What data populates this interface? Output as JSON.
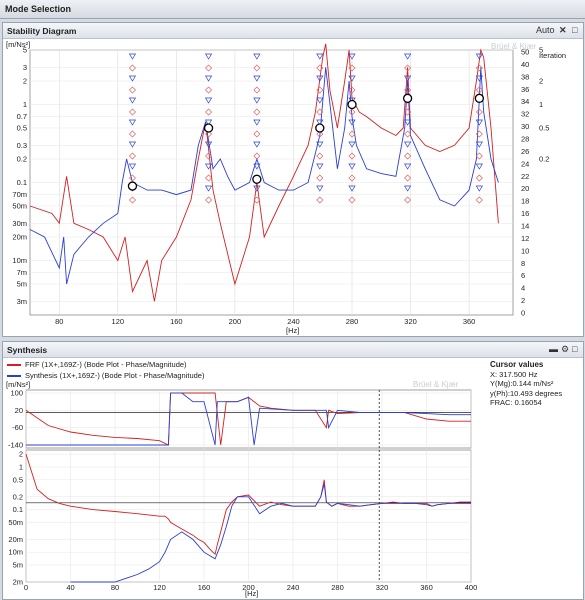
{
  "window": {
    "title": "Mode Selection"
  },
  "stability": {
    "title": "Stability Diagram",
    "auto_label": "Auto",
    "y_unit": "[m/Ns²]",
    "x_unit": "[Hz]",
    "right_title": "Iteration",
    "watermark": "Brüel & Kjær",
    "x_ticks": [
      "80",
      "120",
      "160",
      "200",
      "240",
      "280",
      "320",
      "360"
    ],
    "y_ticks": [
      "5",
      "2",
      "1",
      "0.5",
      "0.2",
      "0.1",
      "50m",
      "20m",
      "10m",
      "5m",
      "3",
      "0.7",
      "0.3",
      "70m",
      "30m",
      "7m",
      "3m"
    ],
    "iter_ticks": [
      "50",
      "40",
      "38",
      "36",
      "34",
      "32",
      "30",
      "28",
      "26",
      "24",
      "22",
      "20",
      "18",
      "16",
      "14",
      "12",
      "10",
      "8",
      "6",
      "4",
      "2",
      "0"
    ],
    "alt_right_ticks": [
      "5",
      "2",
      "1",
      "0.5",
      "0.2"
    ]
  },
  "synthesis": {
    "title": "Synthesis",
    "legend": [
      {
        "label": "FRF (1X+,169Z-) (Bode Plot - Phase/Magnitude)",
        "color": "#d42020"
      },
      {
        "label": "Synthesis (1X+,169Z-) (Bode Plot - Phase/Magnitude)",
        "color": "#2b3fd4"
      }
    ],
    "watermark": "Brüel & Kjær",
    "y_unit": "[m/Ns²]",
    "x_unit": "[Hz]",
    "phase_ticks": [
      "100",
      "20",
      "-60",
      "-140"
    ],
    "mag_ticks": [
      "2",
      "1",
      "0.5",
      "0.2",
      "0.1",
      "50m",
      "20m",
      "10m",
      "5m",
      "2m"
    ],
    "x_ticks": [
      "0",
      "40",
      "80",
      "120",
      "160",
      "200",
      "240",
      "280",
      "320",
      "360",
      "400"
    ]
  },
  "cursor": {
    "title": "Cursor values",
    "x": "X: 317.500 Hz",
    "y_mg": "Y(Mg):0.144 m/Ns²",
    "y_ph": "y(Ph):10.493 degrees",
    "frac": "FRAC: 0.16054"
  },
  "chart_data": [
    {
      "type": "line",
      "title": "Stability Diagram",
      "xlabel": "[Hz]",
      "ylabel": "[m/Ns²]",
      "x_range": [
        60,
        390
      ],
      "y_scale": "log",
      "y_range": [
        0.002,
        5
      ],
      "series": [
        {
          "color": "#d42020",
          "x": [
            60,
            75,
            80,
            85,
            90,
            100,
            110,
            120,
            125,
            130,
            140,
            145,
            150,
            160,
            170,
            175,
            180,
            185,
            190,
            200,
            210,
            215,
            220,
            230,
            240,
            250,
            255,
            260,
            262,
            265,
            270,
            275,
            278,
            280,
            285,
            290,
            300,
            310,
            315,
            318,
            320,
            330,
            340,
            350,
            360,
            365,
            368,
            370,
            375,
            380
          ],
          "y": [
            0.05,
            0.04,
            0.03,
            0.12,
            0.03,
            0.025,
            0.02,
            0.01,
            0.02,
            0.004,
            0.01,
            0.003,
            0.01,
            0.02,
            0.06,
            0.2,
            0.6,
            0.08,
            0.03,
            0.005,
            0.02,
            0.1,
            0.02,
            0.05,
            0.12,
            0.3,
            0.8,
            4,
            6,
            1.5,
            0.5,
            2,
            5,
            1.2,
            0.8,
            0.7,
            0.5,
            0.4,
            0.5,
            3,
            0.5,
            0.3,
            0.25,
            0.3,
            0.5,
            2,
            5,
            4,
            0.5,
            0.03
          ]
        },
        {
          "color": "#2b3fd4",
          "x": [
            60,
            70,
            80,
            83,
            85,
            90,
            100,
            110,
            120,
            123,
            126,
            130,
            140,
            150,
            160,
            170,
            175,
            180,
            185,
            190,
            195,
            200,
            210,
            215,
            220,
            230,
            240,
            250,
            258,
            262,
            265,
            270,
            275,
            278,
            280,
            283,
            290,
            300,
            310,
            316,
            318,
            320,
            330,
            340,
            350,
            360,
            365,
            368,
            370,
            375,
            380
          ],
          "y": [
            0.025,
            0.02,
            0.008,
            0.02,
            0.005,
            0.012,
            0.02,
            0.03,
            0.04,
            0.1,
            0.2,
            0.1,
            0.08,
            0.08,
            0.07,
            0.08,
            0.3,
            0.6,
            0.15,
            0.2,
            0.12,
            0.08,
            0.1,
            0.2,
            0.1,
            0.08,
            0.08,
            0.1,
            0.4,
            3,
            1,
            0.15,
            0.5,
            2,
            0.7,
            0.3,
            0.15,
            0.13,
            0.12,
            0.5,
            2,
            0.4,
            0.15,
            0.06,
            0.05,
            0.08,
            0.2,
            3,
            0.8,
            0.2,
            0.1
          ]
        }
      ],
      "stable_modes_hz": [
        130,
        182,
        215,
        258,
        280,
        318,
        367
      ],
      "stable_modes_y": [
        0.09,
        0.5,
        0.11,
        0.5,
        1.0,
        1.2,
        1.2
      ]
    },
    {
      "type": "line",
      "title": "Synthesis",
      "xlabel": "[Hz]",
      "ylabel": "[m/Ns²]",
      "x_range": [
        0,
        400
      ],
      "series": [
        {
          "name": "FRF (1X+,169Z-) (Bode Plot - Phase/Magnitude)",
          "color": "#d42020",
          "phase_x": [
            0,
            20,
            40,
            60,
            80,
            100,
            120,
            128,
            130,
            140,
            160,
            170,
            175,
            180,
            190,
            200,
            210,
            220,
            240,
            260,
            270,
            272,
            280,
            300,
            320,
            340,
            360,
            380,
            400
          ],
          "phase_y": [
            20,
            -50,
            -80,
            -95,
            -105,
            -110,
            -120,
            -140,
            100,
            100,
            100,
            100,
            -140,
            60,
            60,
            80,
            40,
            30,
            20,
            20,
            -60,
            20,
            5,
            10,
            10,
            10,
            -20,
            -30,
            -30
          ],
          "mag_x": [
            0,
            10,
            20,
            30,
            40,
            60,
            80,
            100,
            110,
            120,
            125,
            128,
            130,
            140,
            150,
            155,
            160,
            165,
            168,
            170,
            172,
            175,
            180,
            185,
            190,
            200,
            210,
            220,
            230,
            240,
            260,
            265,
            268,
            270,
            275,
            280,
            290,
            300,
            310,
            320,
            330,
            340,
            350,
            360,
            365,
            370,
            380,
            390,
            400
          ],
          "mag_y": [
            2,
            0.3,
            0.18,
            0.14,
            0.12,
            0.1,
            0.09,
            0.08,
            0.075,
            0.07,
            0.07,
            0.06,
            0.05,
            0.035,
            0.025,
            0.02,
            0.017,
            0.012,
            0.01,
            0.009,
            0.015,
            0.03,
            0.1,
            0.15,
            0.2,
            0.22,
            0.12,
            0.15,
            0.13,
            0.12,
            0.12,
            0.2,
            0.5,
            0.15,
            0.12,
            0.14,
            0.12,
            0.12,
            0.13,
            0.14,
            0.14,
            0.14,
            0.14,
            0.14,
            0.12,
            0.13,
            0.14,
            0.14,
            0.14
          ]
        },
        {
          "name": "Synthesis (1X+,169Z-) (Bode Plot - Phase/Magnitude)",
          "color": "#2b3fd4",
          "phase_x": [
            0,
            20,
            40,
            60,
            80,
            100,
            120,
            128,
            130,
            140,
            150,
            160,
            170,
            172,
            180,
            190,
            200,
            205,
            210,
            240,
            270,
            272,
            280,
            300,
            320,
            340,
            360,
            380,
            400
          ],
          "phase_y": [
            -140,
            -140,
            -140,
            -140,
            -140,
            -140,
            -140,
            -140,
            100,
            100,
            60,
            60,
            -140,
            60,
            60,
            60,
            80,
            -140,
            30,
            20,
            20,
            -60,
            20,
            10,
            10,
            10,
            5,
            0,
            0
          ],
          "mag_x": [
            40,
            60,
            80,
            100,
            110,
            120,
            125,
            130,
            140,
            150,
            160,
            170,
            175,
            180,
            185,
            190,
            200,
            210,
            220,
            230,
            240,
            260,
            265,
            268,
            270,
            275,
            280,
            290,
            300,
            310,
            320,
            330,
            340,
            350,
            360,
            365,
            370,
            380,
            390,
            400
          ],
          "mag_y": [
            0.002,
            0.002,
            0.002,
            0.003,
            0.004,
            0.006,
            0.01,
            0.02,
            0.03,
            0.02,
            0.01,
            0.007,
            0.015,
            0.04,
            0.12,
            0.2,
            0.2,
            0.08,
            0.12,
            0.14,
            0.12,
            0.12,
            0.2,
            0.4,
            0.15,
            0.12,
            0.14,
            0.13,
            0.12,
            0.13,
            0.14,
            0.15,
            0.14,
            0.14,
            0.13,
            0.12,
            0.13,
            0.14,
            0.15,
            0.15
          ]
        }
      ],
      "cursor_hz": 317.5
    }
  ]
}
